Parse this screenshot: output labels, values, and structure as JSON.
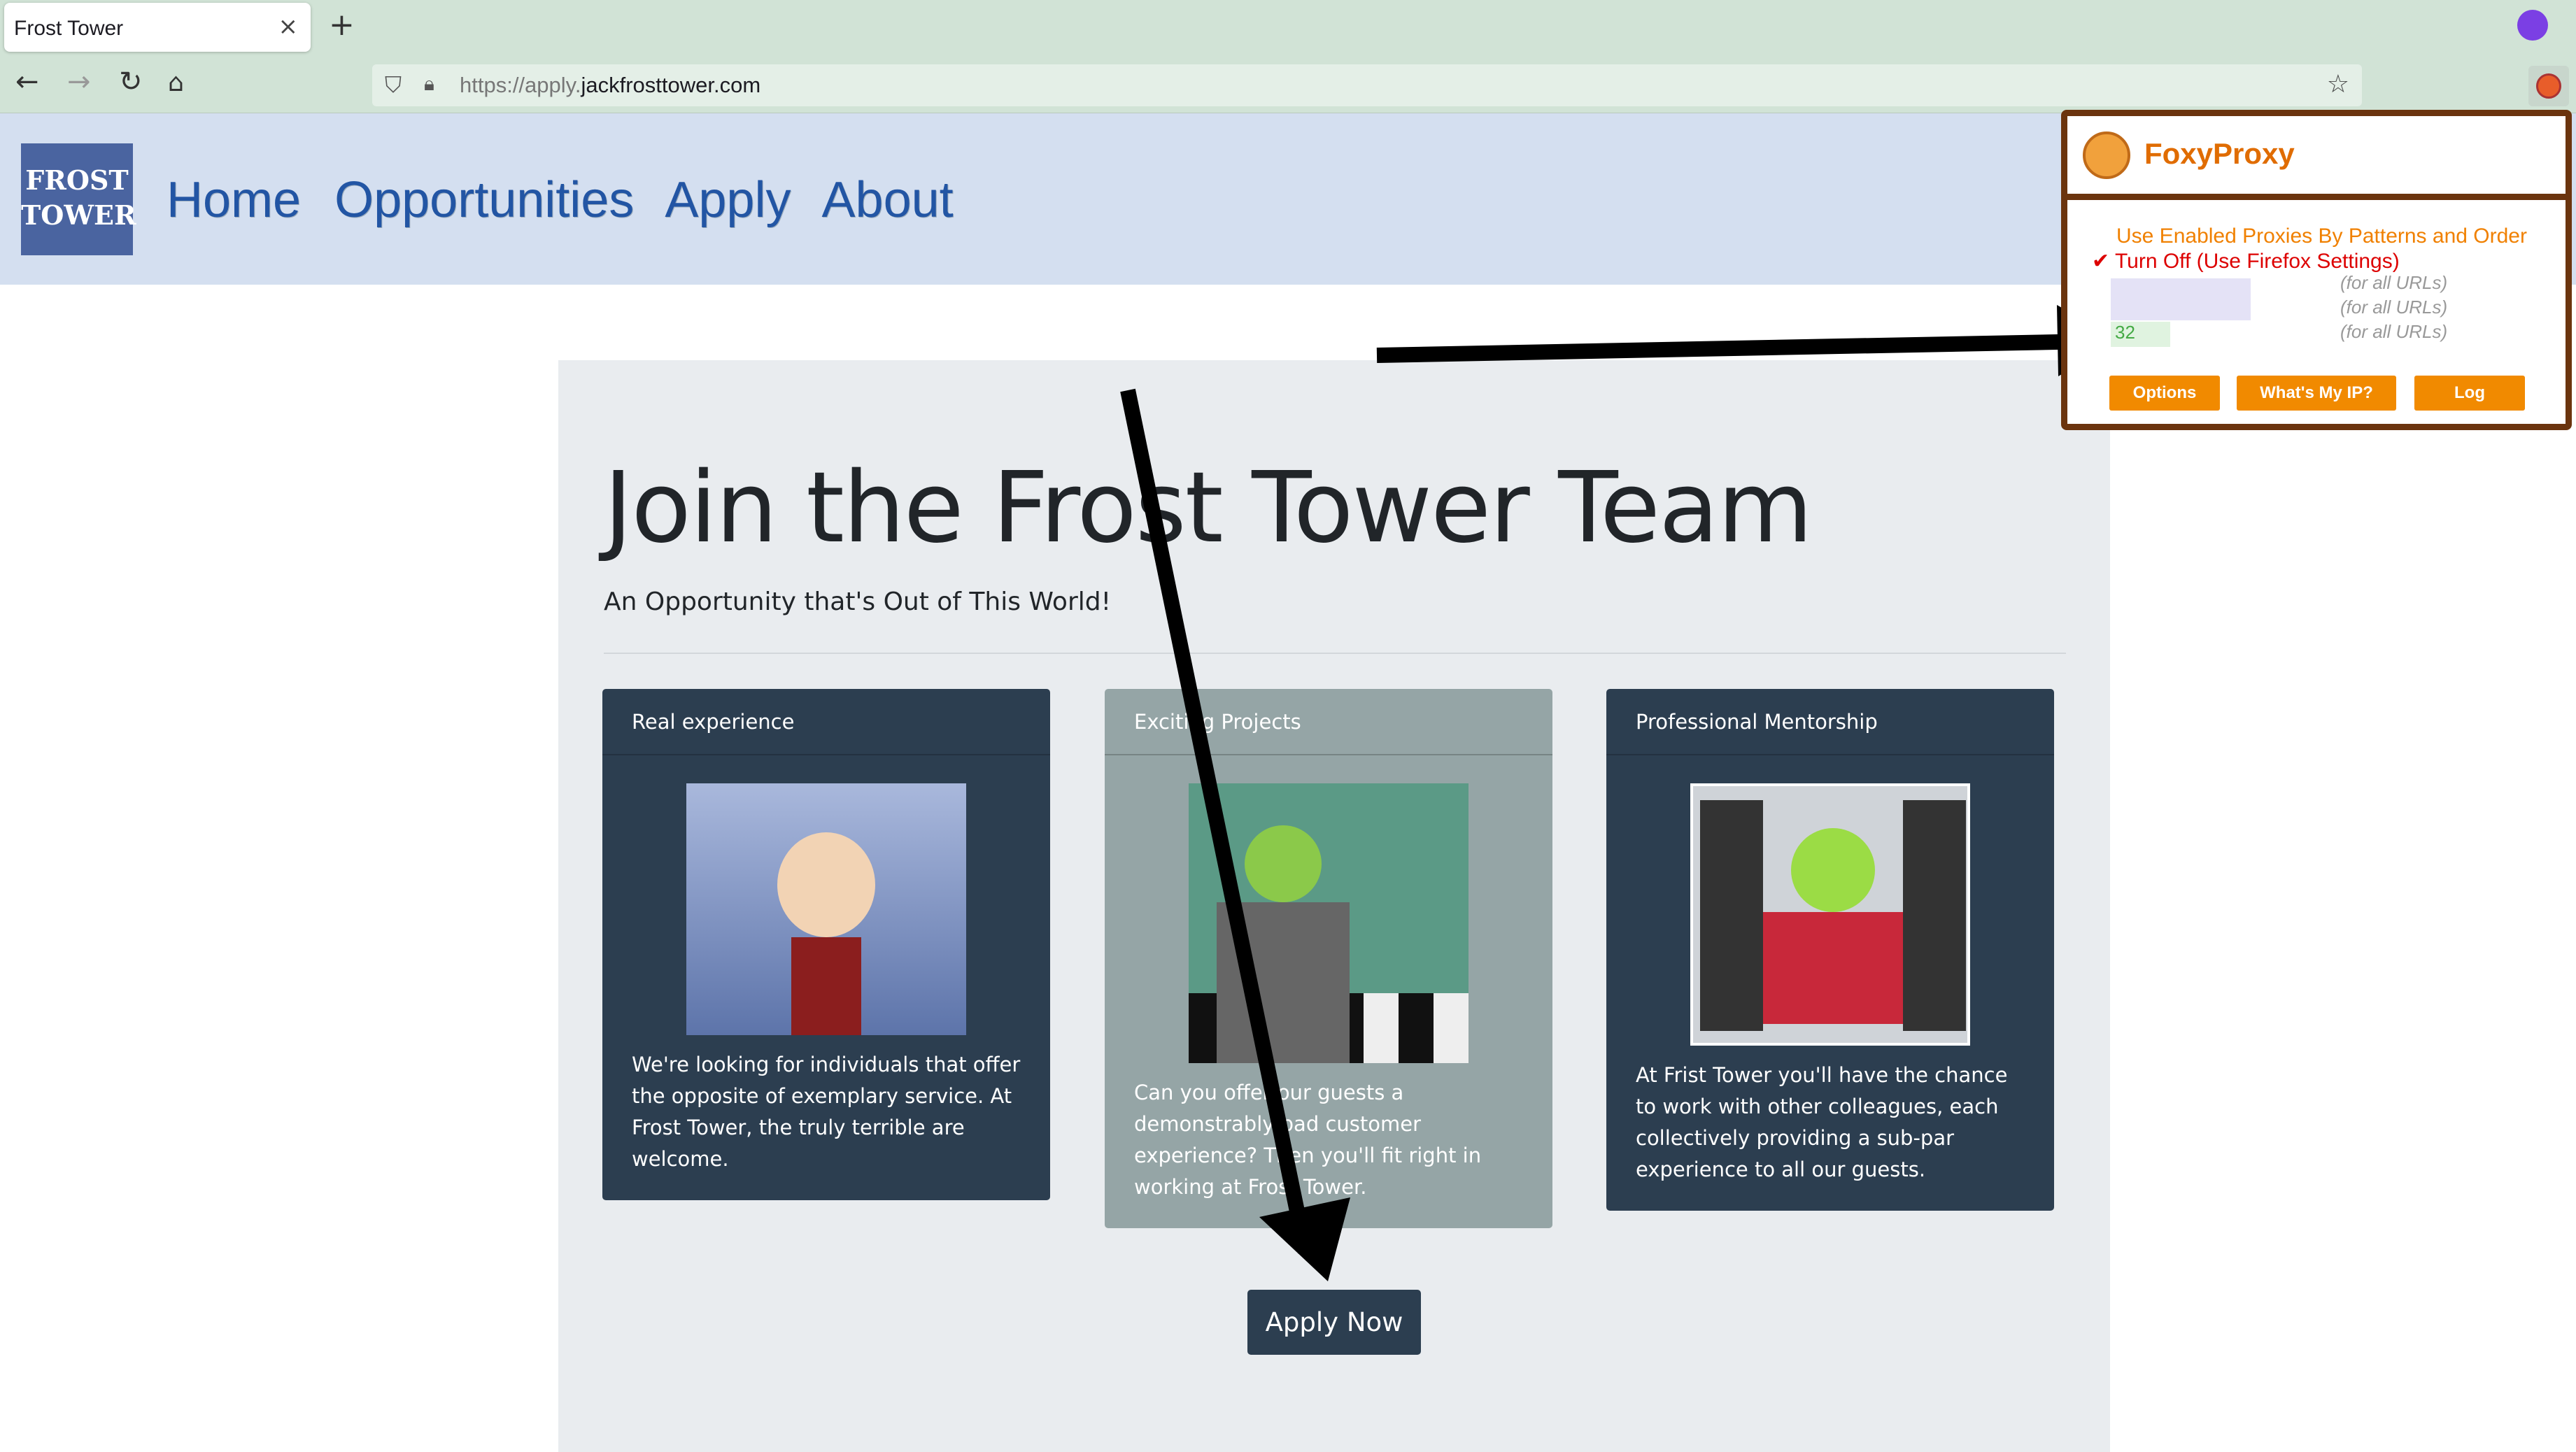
{
  "browser": {
    "tab_title": "Frost Tower",
    "tab_close": "×",
    "new_tab": "+",
    "url_scheme": "https://apply.",
    "url_domain": "jackfrosttower.com",
    "icons": [
      "back-icon",
      "forward-icon",
      "reload-icon",
      "home-icon",
      "shield-icon",
      "lock-icon",
      "star-icon"
    ]
  },
  "site": {
    "logo_lines": [
      "FROST",
      "TOWER"
    ],
    "nav": [
      "Home",
      "Opportunities",
      "Apply",
      "About"
    ]
  },
  "jumbotron": {
    "title": "Join the Frost Tower Team",
    "lead": "An Opportunity that's Out of This World!"
  },
  "cards": [
    {
      "header": "Real experience",
      "text": "We're looking for individuals that offer the opposite of exemplary service. At Frost Tower, the truly terrible are welcome."
    },
    {
      "header": "Exciting Projects",
      "text": "Can you offer our guests a demonstrably bad customer experience? Then you'll fit right in working at Frost Tower."
    },
    {
      "header": "Professional Mentorship",
      "text": "At Frist Tower you'll have the chance to work with other colleagues, each collectively providing a sub-par experience to all our guests."
    }
  ],
  "apply_button": "Apply Now",
  "foxyproxy": {
    "title": "FoxyProxy",
    "mode_patterns": "Use Enabled Proxies By Patterns and Order",
    "check": "✔",
    "mode_off": "Turn Off (Use Firefox Settings)",
    "proxy_urls": [
      "(for all URLs)",
      "(for all URLs)",
      "(for all URLs)"
    ],
    "proxy_fragment": "32",
    "buttons": [
      "Options",
      "What's My IP?",
      "Log"
    ]
  },
  "colors": {
    "accent": "#2c3e50",
    "foxyproxy": "#f18a00",
    "nav_link": "#2255a4"
  }
}
